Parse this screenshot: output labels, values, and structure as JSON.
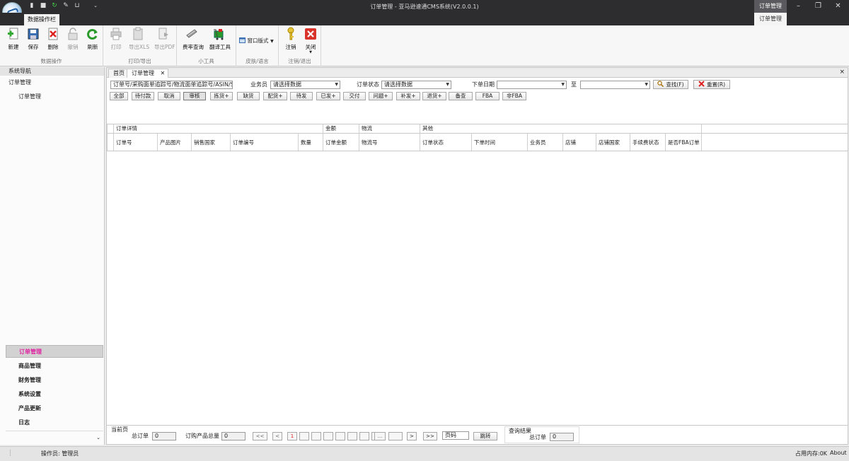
{
  "window": {
    "title": "订单管理 - 亚马逊速通CMS系统(V2.0.0.1)",
    "context_tab": "订单管理",
    "context_sub": "订单管理"
  },
  "ribbon": {
    "active_tab": "数据操作栏",
    "groups": [
      {
        "label": "数据操作",
        "buttons": [
          {
            "label": "新建",
            "icon": "new-icon",
            "enabled": true
          },
          {
            "label": "保存",
            "icon": "save-icon",
            "enabled": true
          },
          {
            "label": "删除",
            "icon": "delete-icon",
            "enabled": true
          },
          {
            "label": "撤销",
            "icon": "lock-icon",
            "enabled": false
          },
          {
            "label": "刷新",
            "icon": "refresh-icon",
            "enabled": true
          }
        ]
      },
      {
        "label": "打印/导出",
        "buttons": [
          {
            "label": "打印",
            "icon": "print-icon",
            "enabled": false
          },
          {
            "label": "导出XLS",
            "icon": "export-xls-icon",
            "enabled": false
          },
          {
            "label": "导出PDF",
            "icon": "export-pdf-icon",
            "enabled": false
          }
        ]
      },
      {
        "label": "小工具",
        "buttons": [
          {
            "label": "费率查询",
            "icon": "rate-query-icon",
            "enabled": true
          },
          {
            "label": "翻译工具",
            "icon": "translate-icon",
            "enabled": true
          }
        ]
      },
      {
        "label": "皮肤/语言",
        "buttons": [
          {
            "label": "窗口版式",
            "icon": "window-layout-icon",
            "enabled": true
          }
        ]
      },
      {
        "label": "注销/退出",
        "buttons": [
          {
            "label": "注销",
            "icon": "key-icon",
            "enabled": true
          },
          {
            "label": "关闭",
            "icon": "close-icon",
            "enabled": true
          }
        ]
      }
    ]
  },
  "sidebar": {
    "header": "系统导航",
    "section": "订单管理",
    "sub_item": "订单管理",
    "bottom_items": [
      "订单管理",
      "商品管理",
      "财务管理",
      "系统设置",
      "产品更新",
      "日志"
    ],
    "active_index": 0
  },
  "doc_tabs": [
    "首页",
    "订单管理"
  ],
  "search": {
    "keyword_placeholder": "订单号/采购面单追踪号/物流面单追踪号/ASIN/SKU",
    "salesman_label": "业务员",
    "salesman_value": "请选择数据",
    "status_label": "订单状态",
    "status_value": "请选择数据",
    "date_label": "下单日期",
    "date_to_label": "至",
    "search_button": "查找(F)",
    "reset_button": "重置(R)"
  },
  "filters": [
    "全部",
    "待付款",
    "取消",
    "审核",
    "拣货+",
    "缺货",
    "配货+",
    "待发",
    "已发+",
    "交付",
    "问题+",
    "补发+",
    "退货+",
    "备查",
    "FBA",
    "非FBA"
  ],
  "filter_selected": 3,
  "grid": {
    "group_headers": [
      "订单详情",
      "金额",
      "物流",
      "其他"
    ],
    "columns": [
      "订单号",
      "产品图片",
      "销售国家",
      "订单编号",
      "数量",
      "订单金额",
      "物流号",
      "订单状态",
      "下单时间",
      "业务员",
      "店铺",
      "店铺国家",
      "手续费状态",
      "是否FBA订单"
    ]
  },
  "pager": {
    "current_label": "当前页",
    "total_orders_label": "总订单",
    "total_orders_value": "0",
    "product_total_label": "订购产品总量",
    "product_total_value": "0",
    "first": "<<",
    "prev": "<",
    "page_current": "1",
    "ellipsis": "...",
    "next": ">",
    "last": ">>",
    "page_input": "页码",
    "jump_button": "跳转",
    "result_label": "查询结果",
    "result_total_label": "总订单",
    "result_total_value": "0"
  },
  "status": {
    "operator": "操作员: 管理员",
    "memory": "占用内存:0K",
    "about": "About"
  }
}
